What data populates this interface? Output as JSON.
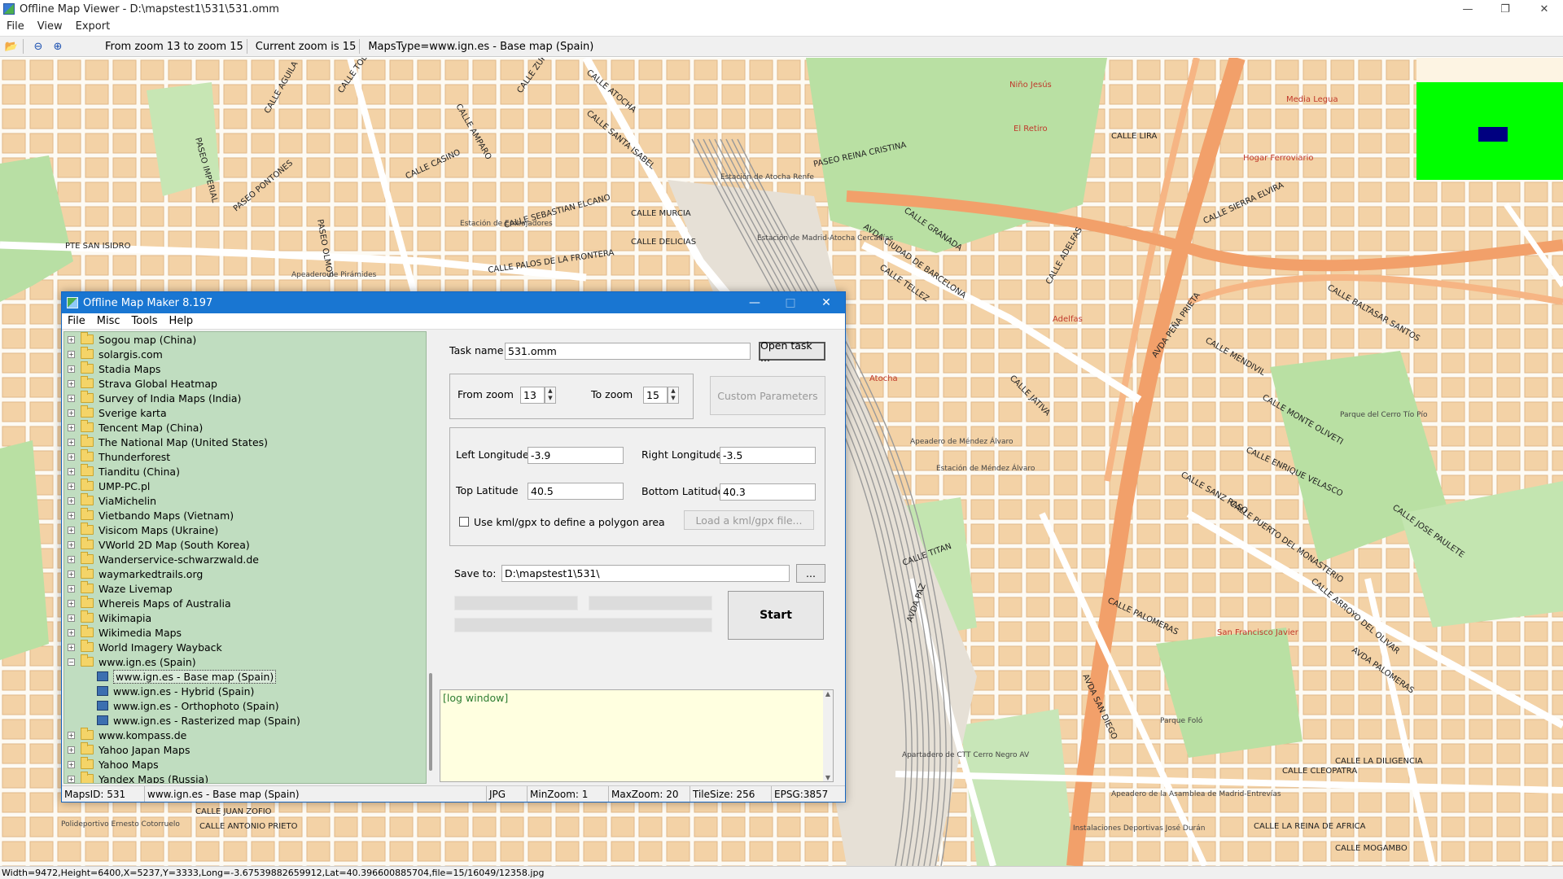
{
  "window": {
    "title": "Offline Map Viewer - D:\\mapstest1\\531\\531.omm",
    "menu": [
      "File",
      "View",
      "Export"
    ],
    "toolbar": {
      "zoom_range": "From zoom 13 to zoom 15",
      "current_zoom": "Current zoom is 15",
      "maps_type": "MapsType=www.ign.es - Base map (Spain)"
    },
    "status": "Width=9472,Height=6400,X=5237,Y=3333,Long=-3.67539882659912,Lat=40.396600885704,file=15/16049/12358.jpg"
  },
  "map": {
    "streets": [
      "CALLE ATOCHA",
      "CALLE ZURITA",
      "CALLE SANTA ISABEL",
      "CALLE AMPARO",
      "CALLE TOLEDO",
      "CALLE AGUILA",
      "CALLE CASINO",
      "PASEO REINA CRISTINA",
      "CALLE LIRA",
      "PASEO PONTONES",
      "CALLE SEBASTIAN ELCANO",
      "CALLE MURCIA",
      "CALLE DELICIAS",
      "CALLE PALOS DE LA FRONTERA",
      "AVDA CIUDAD DE BARCELONA",
      "CALLE GRANADA",
      "CALLE SIERRA ELVIRA",
      "CALLE BALTASAR SANTOS",
      "AVDA PEÑA PRIETA",
      "CALLE MENDIVIL",
      "CALLE MONTE OLIVETI",
      "CALLE ENRIQUE VELASCO",
      "CALLE SANZ RASO",
      "CALLE PUERTO DEL MONASTERIO",
      "CALLE JOSE PAULETE",
      "CALLE PALOMERAS",
      "CALLE ARROYO DEL OLIVAR",
      "AVDA PALOMERAS",
      "CALLE CLEOPATRA",
      "CALLE LA DILIGENCIA",
      "CALLE LA REINA DE AFRICA",
      "CALLE MOGAMBO",
      "CALLE ANTONIO PRIETO",
      "CALLE JUAN ZOFIO",
      "CALLE TITAN",
      "AVDA PAZ",
      "CALLE TELLEZ",
      "CALLE ADELFAS",
      "CALLE JATIVA",
      "AVDA SAN DIEGO",
      "PASEO IMPERIAL",
      "PASEO OLMOS",
      "PTE SAN ISIDRO"
    ],
    "pois": [
      "El Retiro",
      "Hogar Ferroviario",
      "Media Legua",
      "Adelfas",
      "Atocha",
      "San Francisco Javier",
      "Niño Jesús"
    ],
    "places": [
      "Estación de Atocha Renfe",
      "Estación de Madrid-Atocha Cercanías",
      "Estación de Embajadores",
      "Apeadero de Pirámides",
      "Apeadero de Méndez Álvaro",
      "Estación de Méndez Álvaro",
      "Parque del Cerro Tío Pío",
      "Parque Foló",
      "Apartadero de CTT Cerro Negro AV",
      "Apeadero de la Asamblea de Madrid-Entrevías",
      "Instalaciones Deportivas José Durán",
      "Polideportivo Ernesto Cotorruelo"
    ]
  },
  "dialog": {
    "title": "Offline Map Maker 8.197",
    "menu": [
      "File",
      "Misc",
      "Tools",
      "Help"
    ],
    "tree": [
      {
        "label": "Sogou map (China)"
      },
      {
        "label": "solargis.com"
      },
      {
        "label": "Stadia Maps"
      },
      {
        "label": "Strava Global Heatmap"
      },
      {
        "label": "Survey of India Maps (India)"
      },
      {
        "label": "Sverige karta"
      },
      {
        "label": "Tencent Map (China)"
      },
      {
        "label": "The National Map (United States)"
      },
      {
        "label": "Thunderforest"
      },
      {
        "label": "Tianditu (China)"
      },
      {
        "label": "UMP-PC.pl"
      },
      {
        "label": "ViaMichelin"
      },
      {
        "label": "Vietbando Maps (Vietnam)"
      },
      {
        "label": "Visicom Maps (Ukraine)"
      },
      {
        "label": "VWorld 2D Map (South Korea)"
      },
      {
        "label": "Wanderservice-schwarzwald.de"
      },
      {
        "label": "waymarkedtrails.org"
      },
      {
        "label": "Waze Livemap"
      },
      {
        "label": "Whereis Maps of Australia"
      },
      {
        "label": "Wikimapia"
      },
      {
        "label": "Wikimedia Maps"
      },
      {
        "label": "World Imagery Wayback"
      },
      {
        "label": "www.ign.es (Spain)",
        "expanded": true
      },
      {
        "label": "www.ign.es - Base map (Spain)",
        "child": true,
        "selected": true
      },
      {
        "label": "www.ign.es - Hybrid (Spain)",
        "child": true
      },
      {
        "label": "www.ign.es - Orthophoto (Spain)",
        "child": true
      },
      {
        "label": "www.ign.es - Rasterized map (Spain)",
        "child": true
      },
      {
        "label": "www.kompass.de"
      },
      {
        "label": "Yahoo Japan Maps"
      },
      {
        "label": "Yahoo Maps"
      },
      {
        "label": "Yandex Maps (Russia)"
      }
    ],
    "task_name_label": "Task name",
    "task_name_value": "531.omm",
    "open_task_label": "Open task ...",
    "from_zoom_label": "From zoom",
    "from_zoom_value": "13",
    "to_zoom_label": "To zoom",
    "to_zoom_value": "15",
    "custom_params_label": "Custom Parameters",
    "left_lon_label": "Left Longitude",
    "left_lon_value": "-3.9",
    "right_lon_label": "Right Longitude",
    "right_lon_value": "-3.5",
    "top_lat_label": "Top Latitude",
    "top_lat_value": "40.5",
    "bottom_lat_label": "Bottom Latitude",
    "bottom_lat_value": "40.3",
    "kml_checkbox_label": "Use kml/gpx to define a polygon area",
    "load_kml_label": "Load a kml/gpx file...",
    "save_to_label": "Save to:",
    "save_to_value": "D:\\mapstest1\\531\\",
    "browse_label": "...",
    "start_label": "Start",
    "log_text": "[log window]",
    "status": {
      "maps_id": "MapsID: 531",
      "maps_name": "www.ign.es - Base map (Spain)",
      "format": "JPG",
      "min_zoom": "MinZoom: 1",
      "max_zoom": "MaxZoom: 20",
      "tile_size": "TileSize: 256",
      "epsg": "EPSG:3857"
    }
  },
  "colors": {
    "dialog_title": "#1976d2",
    "tree_bg": "#c0ddc0",
    "log_bg": "#ffffe0",
    "overview_green": "#00ff00",
    "overview_rect": "#000080"
  }
}
